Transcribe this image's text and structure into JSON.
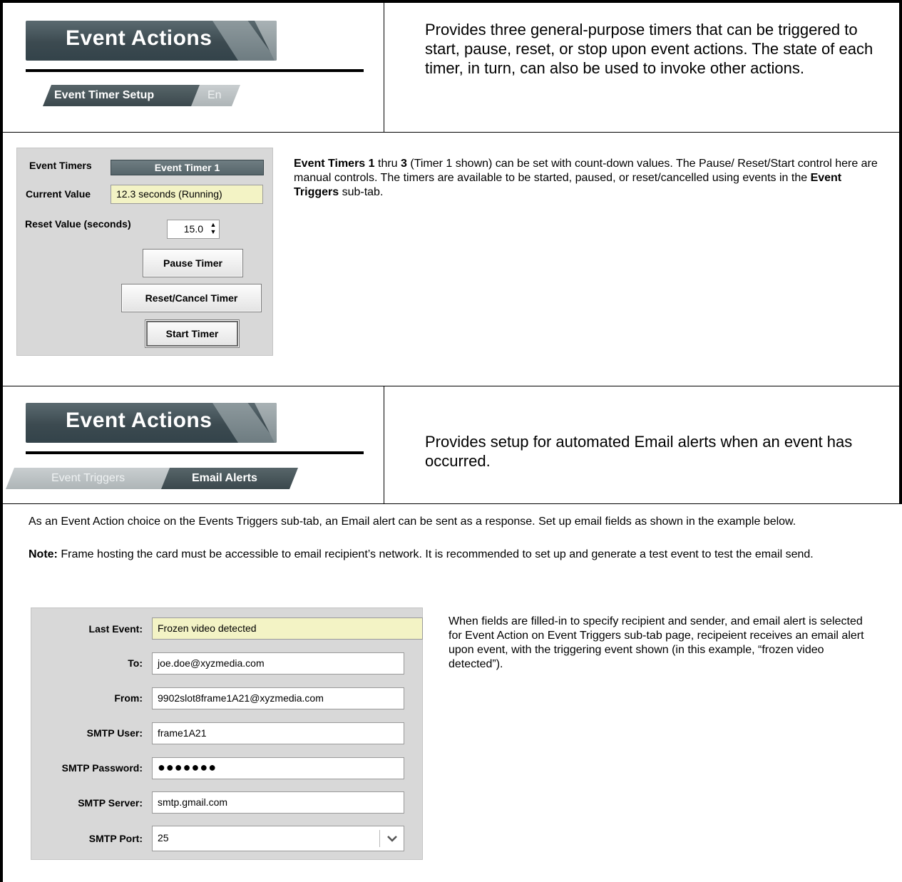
{
  "section1": {
    "banner_title": "Event Actions",
    "subtabs": [
      "Event Timer Setup",
      "En"
    ],
    "description": "Provides three general-purpose timers that can be triggered to start, pause, reset, or stop upon event actions. The state of each timer, in turn, can also be used to invoke other actions."
  },
  "timer_panel": {
    "event_timers_label": "Event Timers",
    "event_timer_selected": "Event Timer 1",
    "current_value_label": "Current Value",
    "current_value": "12.3 seconds (Running)",
    "reset_value_label": "Reset Value (seconds)",
    "reset_value": "15.0",
    "pause_button": "Pause Timer",
    "reset_button": "Reset/Cancel Timer",
    "start_button": "Start Timer"
  },
  "timer_text": {
    "p1_bold": "Event Timers 1",
    "p2": " thru ",
    "p3_bold": "3",
    "p4": " (Timer 1 shown) can be set with count-down values. The Pause/ Reset/Start control here are manual controls. The timers are available to be started, paused, or reset/cancelled using events in the ",
    "p5_bold": "Event Triggers",
    "p6": " sub-tab."
  },
  "section2": {
    "banner_title": "Event Actions",
    "subtabs": [
      "Event Triggers",
      "Email Alerts"
    ],
    "description": "Provides setup for automated Email alerts when an event has occurred."
  },
  "email_intro": {
    "paragraph": "As an Event Action choice on the Events Triggers sub-tab, an Email alert can be sent as a response. Set up email fields as shown in the example below.",
    "note_label": "Note:",
    "note_text": " Frame hosting the card must be accessible to email recipient’s network. It is recommended to set up and generate a test event to test the email send."
  },
  "email_panel": {
    "last_event_label": "Last Event:",
    "last_event": "Frozen video detected",
    "to_label": "To:",
    "to": "joe.doe@xyzmedia.com",
    "from_label": "From:",
    "from": "9902slot8frame1A21@xyzmedia.com",
    "smtp_user_label": "SMTP User:",
    "smtp_user": "frame1A21",
    "smtp_password_label": "SMTP Password:",
    "smtp_password": "●●●●●●●",
    "smtp_server_label": "SMTP Server:",
    "smtp_server": "smtp.gmail.com",
    "smtp_port_label": "SMTP Port:",
    "smtp_port": "25"
  },
  "email_description": "When fields are filled-in to specify recipient and sender, and email alert is selected for Event Action on Event Triggers sub-tab page, recipeient receives an email alert upon event, with the triggering event shown (in this example, “frozen video detected”)."
}
